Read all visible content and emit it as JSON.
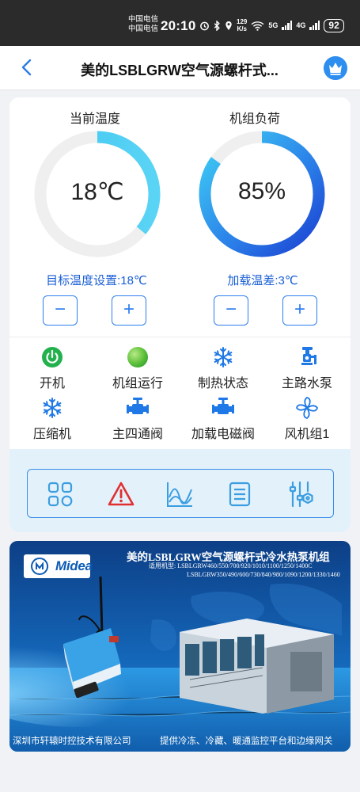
{
  "status_bar": {
    "carrier_1": "中国电信",
    "carrier_2": "中国电信",
    "time": "20:10",
    "net_speed_value": "129",
    "net_speed_unit": "K/s",
    "net_type_1": "5G",
    "net_type_2": "4G",
    "battery": "92"
  },
  "header": {
    "title": "美的LSBLGRW空气源螺杆式...",
    "back_icon": "chevron-left-icon",
    "vip_icon": "crown-icon"
  },
  "gauges": [
    {
      "label": "当前温度",
      "value_text": "18℃",
      "fill_fraction": 0.36,
      "style": "light-blue"
    },
    {
      "label": "机组负荷",
      "value_text": "85%",
      "fill_fraction": 0.85,
      "style": "blue-gradient"
    }
  ],
  "settings": {
    "target_temp_label": "目标温度设置:18℃",
    "load_diff_label": "加载温差:3℃",
    "minus": "−",
    "plus": "+"
  },
  "status_items": [
    {
      "label": "开机",
      "icon": "power-icon"
    },
    {
      "label": "机组运行",
      "icon": "running-indicator-icon"
    },
    {
      "label": "制热状态",
      "icon": "snowflake-icon"
    },
    {
      "label": "主路水泵",
      "icon": "water-pump-icon"
    },
    {
      "label": "压缩机",
      "icon": "snowflake-icon"
    },
    {
      "label": "主四通阀",
      "icon": "valve-icon"
    },
    {
      "label": "加载电磁阀",
      "icon": "valve-icon"
    },
    {
      "label": "风机组1",
      "icon": "fan-icon"
    }
  ],
  "toolbar": [
    {
      "icon": "grid-icon"
    },
    {
      "icon": "alarm-warning-icon"
    },
    {
      "icon": "line-chart-icon"
    },
    {
      "icon": "document-list-icon"
    },
    {
      "icon": "settings-sliders-icon"
    }
  ],
  "banner": {
    "logo_text": "Midea",
    "title": "美的LSBLGRW空气源螺杆式冷水热泵机组",
    "models_line_1": "适用机型:  LSBLGRW460/550/700/920/1010/1100/1250/1400C",
    "models_line_2": "LSBLGRW350/490/600/730/840/980/1090/1200/1330/1460",
    "footer_left": "深圳市轩辕时控技术有限公司",
    "footer_right": "提供冷冻、冷藏、暖通监控平台和边缘网关"
  },
  "colors": {
    "accent": "#2e7ff0",
    "gauge_light": "#40c8f0",
    "gauge_dark": "#1a4fd8",
    "power_green": "#22b14c",
    "alarm_red": "#e03030",
    "toolbar_bg": "#e3f1fb"
  }
}
